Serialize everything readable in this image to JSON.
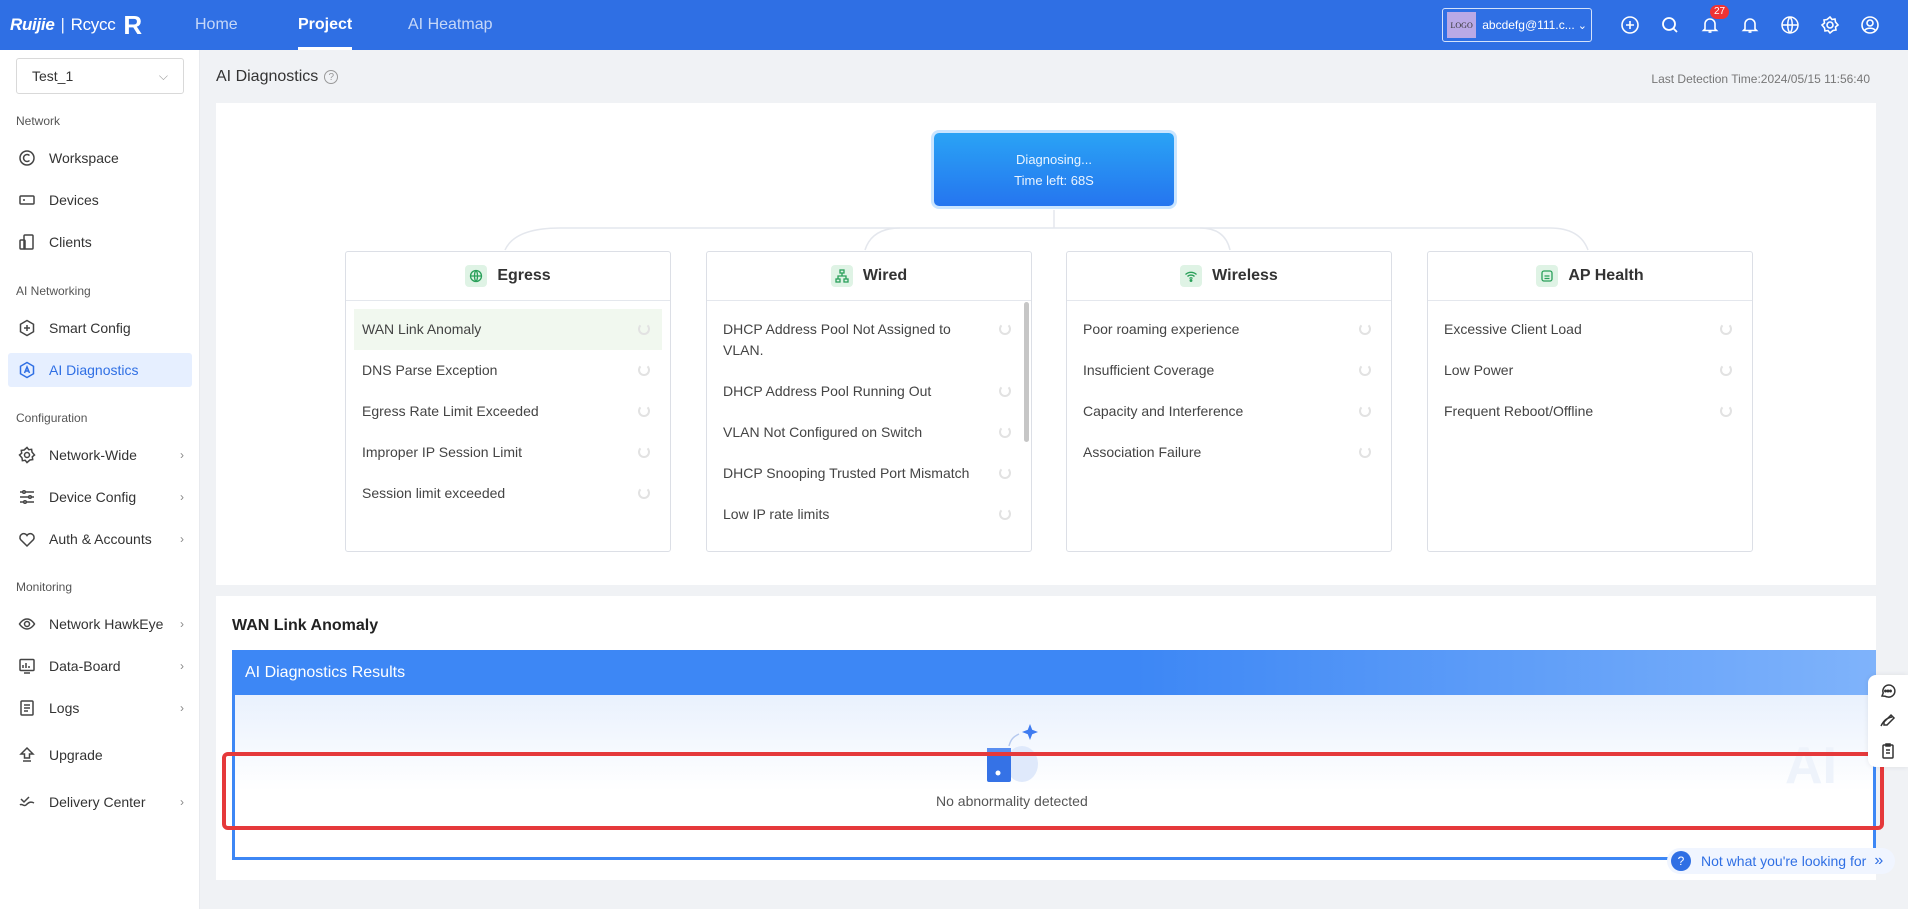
{
  "brand": {
    "name": "Ruijie",
    "sub": "Rcycc",
    "mark": "R"
  },
  "nav": [
    {
      "label": "Home"
    },
    {
      "label": "Project"
    },
    {
      "label": "AI Heatmap"
    }
  ],
  "account": {
    "logo_text": "LOGO",
    "email": "abcdefg@111.c...",
    "chevron": "⌄"
  },
  "top_icons": {
    "add": "plus-circle-icon",
    "search": "search-icon",
    "alerts": "bell-icon",
    "alert_count": "27",
    "notify": "bell-icon",
    "language": "globe-icon",
    "settings": "gear-icon",
    "user": "user-icon"
  },
  "sidebar": {
    "project": "Test_1",
    "sections": {
      "network": "Network",
      "ai": "AI Networking",
      "config": "Configuration",
      "monitoring": "Monitoring"
    },
    "items": {
      "workspace": "Workspace",
      "devices": "Devices",
      "clients": "Clients",
      "smart_config": "Smart Config",
      "ai_diagnostics": "AI Diagnostics",
      "network_wide": "Network-Wide",
      "device_config": "Device Config",
      "auth": "Auth & Accounts",
      "hawkeye": "Network HawkEye",
      "databoard": "Data-Board",
      "logs": "Logs",
      "upgrade": "Upgrade",
      "delivery": "Delivery Center"
    }
  },
  "page": {
    "title": "AI Diagnostics",
    "last_detection": "Last Detection Time:2024/05/15 11:56:40"
  },
  "diagnosing": {
    "line1": "Diagnosing...",
    "line2": "Time left: 68S"
  },
  "cards": {
    "egress": {
      "title": "Egress",
      "items": [
        "WAN Link Anomaly",
        "DNS Parse Exception",
        "Egress Rate Limit Exceeded",
        "Improper IP Session Limit",
        "Session limit exceeded"
      ]
    },
    "wired": {
      "title": "Wired",
      "items": [
        "DHCP Address Pool Not Assigned to VLAN.",
        "DHCP Address Pool Running Out",
        "VLAN Not Configured on Switch",
        "DHCP Snooping Trusted Port Mismatch",
        "Low IP rate limits"
      ]
    },
    "wireless": {
      "title": "Wireless",
      "items": [
        "Poor roaming experience",
        "Insufficient Coverage",
        "Capacity and Interference",
        "Association Failure"
      ]
    },
    "ap": {
      "title": "AP Health",
      "items": [
        "Excessive Client Load",
        "Low Power",
        "Frequent Reboot/Offline"
      ]
    }
  },
  "result": {
    "section_title": "WAN Link Anomaly",
    "header": "AI Diagnostics Results",
    "empty": "No abnormality detected",
    "watermark": "AI"
  },
  "help": {
    "label": "Not what you're looking for",
    "chevrons": "»"
  }
}
